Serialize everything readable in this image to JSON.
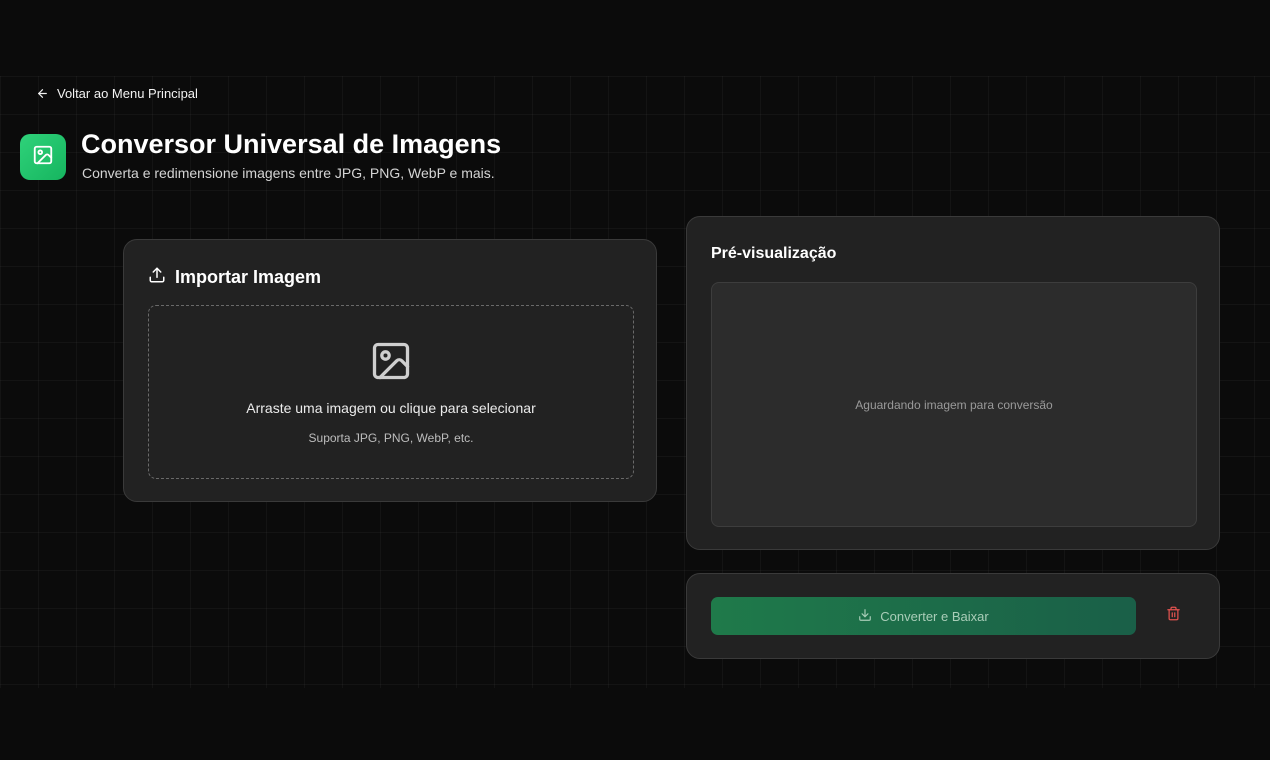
{
  "nav": {
    "back_label": "Voltar ao Menu Principal",
    "back_icon": "arrow-left-icon"
  },
  "header": {
    "icon": "image-icon",
    "title": "Conversor Universal de Imagens",
    "subtitle": "Converta e redimensione imagens entre JPG, PNG, WebP e mais."
  },
  "import_card": {
    "icon": "upload-icon",
    "heading": "Importar Imagem",
    "dropzone": {
      "icon": "image-icon",
      "title": "Arraste uma imagem ou clique para selecionar",
      "subtitle": "Suporta JPG, PNG, WebP, etc."
    }
  },
  "preview_card": {
    "heading": "Pré-visualização",
    "placeholder": "Aguardando imagem para conversão"
  },
  "actions": {
    "convert_label": "Converter e Baixar",
    "convert_icon": "download-icon",
    "delete_icon": "trash-icon"
  },
  "colors": {
    "background": "#0b0b0b",
    "card": "#222222",
    "accent_green": "#22c56d",
    "button_green": "#1f7a4a",
    "danger_red": "#e0524f"
  }
}
